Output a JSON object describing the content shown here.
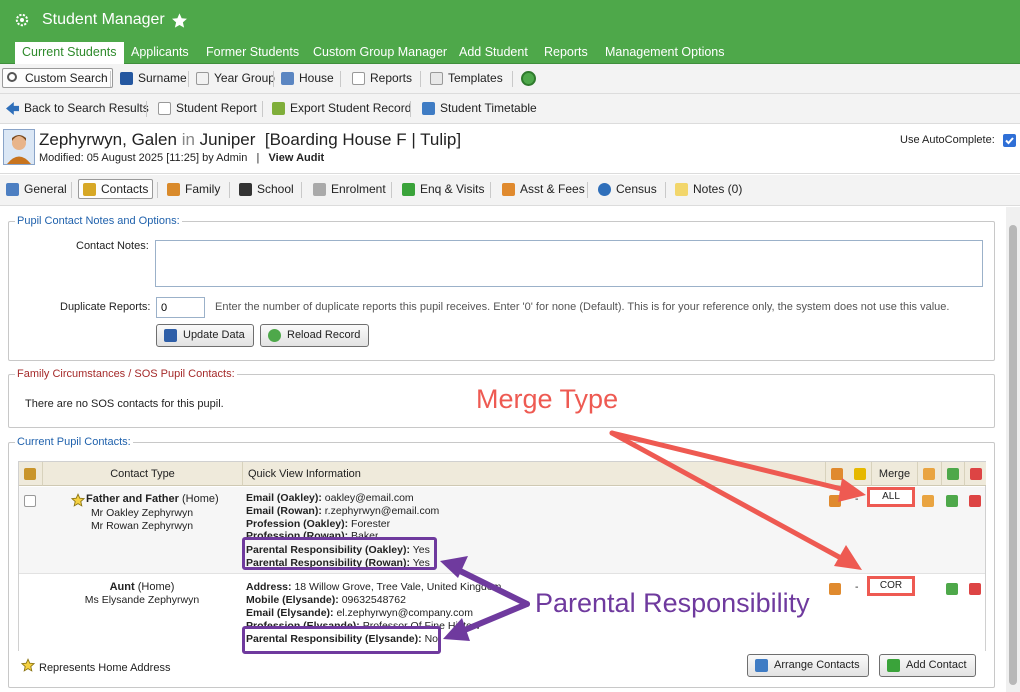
{
  "app": {
    "title": "Student Manager"
  },
  "nav": {
    "tabs": [
      "Current Students",
      "Applicants",
      "Former Students",
      "Custom Group Manager",
      "Add Student",
      "Reports",
      "Management Options"
    ],
    "active": "Current Students"
  },
  "toolbar1": {
    "custom_search": "Custom Search",
    "surname": "Surname",
    "year_group": "Year Group",
    "house": "House",
    "reports": "Reports",
    "templates": "Templates"
  },
  "toolbar2": {
    "back": "Back to Search Results",
    "student_report": "Student Report",
    "export": "Export Student Record",
    "timetable": "Student Timetable"
  },
  "pupil": {
    "surname_first": "Zephyrwyn, Galen",
    "in_word": "in",
    "group": "Juniper",
    "house_label": "[Boarding House F | Tulip]",
    "modified": "Modified: 05 August 2025 [11:25] by Admin",
    "separator": "|",
    "view_audit": "View Audit",
    "autocomplete_label": "Use AutoComplete:"
  },
  "tabs2": {
    "general": "General",
    "contacts": "Contacts",
    "family": "Family",
    "school": "School",
    "enrolment": "Enrolment",
    "enq": "Enq & Visits",
    "asst": "Asst & Fees",
    "census": "Census",
    "notes": "Notes (0)"
  },
  "notes_section": {
    "legend": "Pupil Contact Notes and Options:",
    "contact_notes_label": "Contact Notes:",
    "duplicate_label": "Duplicate Reports:",
    "duplicate_value": "0",
    "duplicate_help": "Enter the number of duplicate reports this pupil receives. Enter '0' for none (Default). This is for your reference only, the system does not use this value.",
    "update_btn": "Update Data",
    "reload_btn": "Reload Record"
  },
  "sos": {
    "legend": "Family Circumstances / SOS Pupil Contacts:",
    "message": "There are no SOS contacts for this pupil."
  },
  "contacts": {
    "legend": "Current Pupil Contacts:",
    "headers": {
      "contact_type": "Contact Type",
      "quick_view": "Quick View Information",
      "merge": "Merge"
    },
    "rows": [
      {
        "type": "Father and Father",
        "home": "(Home)",
        "names": [
          "Mr Oakley Zephyrwyn",
          "Mr Rowan Zephyrwyn"
        ],
        "info": [
          {
            "k": "Email (Oakley):",
            "v": "oakley@email.com"
          },
          {
            "k": "Email (Rowan):",
            "v": "r.zephyrwyn@email.com"
          },
          {
            "k": "Profession (Oakley):",
            "v": "Forester"
          },
          {
            "k": "Profession (Rowan):",
            "v": "Baker"
          },
          {
            "k": "Parental Responsibility (Oakley):",
            "v": "Yes"
          },
          {
            "k": "Parental Responsibility (Rowan):",
            "v": "Yes"
          }
        ],
        "dash": "-",
        "merge": "ALL"
      },
      {
        "type": "Aunt",
        "home": "(Home)",
        "names": [
          "Ms Elysande Zephyrwyn"
        ],
        "info": [
          {
            "k": "Address:",
            "v": "18 Willow Grove, Tree Vale, United Kingdom"
          },
          {
            "k": "Mobile (Elysande):",
            "v": "09632548762"
          },
          {
            "k": "Email (Elysande):",
            "v": "el.zephyrwyn@company.com"
          },
          {
            "k": "Profession (Elysande):",
            "v": "Professor Of Fine History"
          },
          {
            "k": "Parental Responsibility (Elysande):",
            "v": "No"
          }
        ],
        "dash": "-",
        "merge": "COR"
      }
    ],
    "footer_note": "Represents Home Address",
    "arrange_btn": "Arrange Contacts",
    "add_btn": "Add Contact"
  },
  "annotations": {
    "merge_type": "Merge Type",
    "parental_responsibility": "Parental Responsibility"
  },
  "colors": {
    "brand_green": "#4ea84a",
    "annotation_red": "#ee5a52",
    "annotation_purple": "#6f3a9e",
    "legend_blue": "#1f61ac"
  }
}
